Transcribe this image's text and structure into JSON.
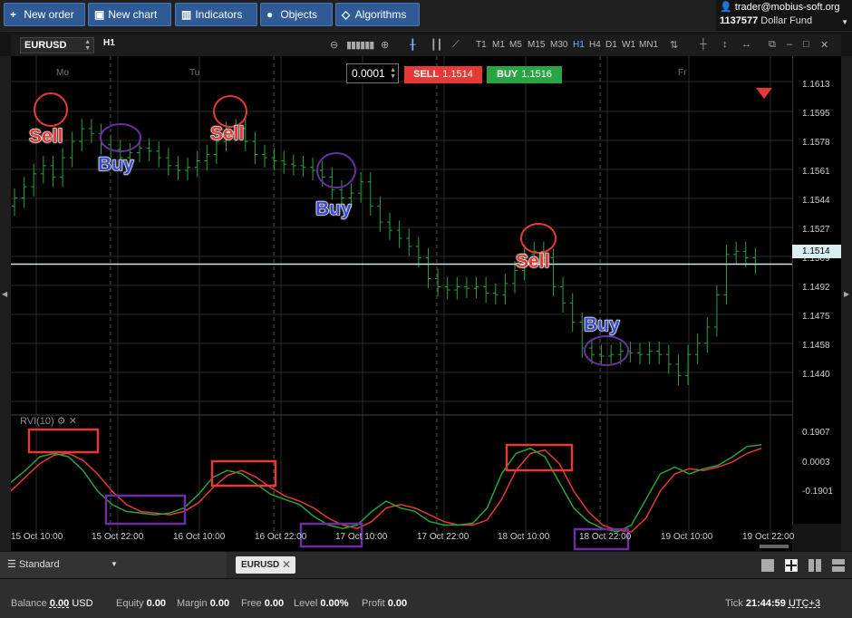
{
  "toolbar": {
    "new_order": "New order",
    "new_chart": "New chart",
    "indicators": "Indicators",
    "objects": "Objects",
    "algorithms": "Algorithms"
  },
  "account": {
    "user": "trader@mobius-soft.org",
    "number": "1137577",
    "fund": "Dollar Fund"
  },
  "chart_toolbar": {
    "symbol": "EURUSD",
    "timeframe": "H1",
    "timeframes": [
      "T1",
      "M1",
      "M5",
      "M15",
      "M30",
      "H1",
      "H4",
      "D1",
      "W1",
      "MN1"
    ],
    "active_timeframe": "H1"
  },
  "order": {
    "quantity": "0.0001",
    "sell_label": "SELL",
    "sell_price": "1.1514",
    "buy_label": "BUY",
    "buy_price": "1.1516"
  },
  "price_axis": {
    "labels": [
      "1.1613",
      "1.1595",
      "1.1578",
      "1.1561",
      "1.1544",
      "1.1527",
      "1.1509",
      "1.1492",
      "1.1475",
      "1.1458",
      "1.1440"
    ],
    "current": "1.1514"
  },
  "indicator": {
    "name": "RVI(10)",
    "labels": [
      "0.1907",
      "0.0003",
      "-0.1901"
    ]
  },
  "day_labels": [
    "Mo",
    "Tu",
    "Fr"
  ],
  "time_axis": [
    "15 Oct 10:00",
    "15 Oct 22:00",
    "16 Oct 10:00",
    "16 Oct 22:00",
    "17 Oct 10:00",
    "17 Oct 22:00",
    "18 Oct 10:00",
    "18 Oct 22:00",
    "19 Oct 10:00",
    "19 Oct 22:00"
  ],
  "annotations": {
    "sell": "Sell",
    "buy": "Buy"
  },
  "chart_data": {
    "type": "bar",
    "title": "",
    "ylim": [
      1.1425,
      1.1635
    ],
    "current_price": 1.1514,
    "ohlc_close": [
      1.1555,
      1.1562,
      1.157,
      1.1575,
      1.1568,
      1.158,
      1.159,
      1.1598,
      1.1595,
      1.1588,
      1.1585,
      1.158,
      1.1583,
      1.1586,
      1.1584,
      1.158,
      1.1575,
      1.1572,
      1.1574,
      1.1578,
      1.1582,
      1.159,
      1.1596,
      1.1598,
      1.159,
      1.1582,
      1.158,
      1.1578,
      1.1576,
      1.1575,
      1.1574,
      1.1572,
      1.1568,
      1.156,
      1.1555,
      1.1558,
      1.1565,
      1.155,
      1.154,
      1.1535,
      1.153,
      1.1525,
      1.1518,
      1.1505,
      1.15,
      1.1498,
      1.15,
      1.1499,
      1.15,
      1.1496,
      1.1495,
      1.1502,
      1.151,
      1.152,
      1.1522,
      1.1518,
      1.15,
      1.149,
      1.1478,
      1.1462,
      1.1458,
      1.1457,
      1.1458,
      1.146,
      1.1459,
      1.1458,
      1.146,
      1.1458,
      1.1452,
      1.1445,
      1.1458,
      1.1465,
      1.1475,
      1.1495,
      1.152,
      1.1522,
      1.1518,
      1.1514
    ],
    "rvi_ylim": [
      -0.32,
      0.36
    ],
    "rvi_main": [
      0.05,
      0.12,
      0.2,
      0.22,
      0.2,
      0.12,
      0.0,
      -0.08,
      -0.12,
      -0.13,
      -0.14,
      -0.13,
      -0.1,
      -0.02,
      0.08,
      0.12,
      0.1,
      0.04,
      -0.02,
      -0.05,
      -0.08,
      -0.15,
      -0.2,
      -0.22,
      -0.2,
      -0.12,
      -0.06,
      -0.1,
      -0.12,
      -0.18,
      -0.2,
      -0.2,
      -0.19,
      -0.1,
      0.1,
      0.22,
      0.25,
      0.2,
      0.05,
      -0.1,
      -0.18,
      -0.22,
      -0.24,
      -0.2,
      -0.05,
      0.1,
      0.14,
      0.1,
      0.13,
      0.15,
      0.2,
      0.26,
      0.27
    ],
    "rvi_signal": [
      0.0,
      0.08,
      0.16,
      0.21,
      0.22,
      0.18,
      0.1,
      0.0,
      -0.08,
      -0.12,
      -0.13,
      -0.14,
      -0.12,
      -0.07,
      0.02,
      0.09,
      0.12,
      0.08,
      0.02,
      -0.03,
      -0.06,
      -0.1,
      -0.16,
      -0.2,
      -0.22,
      -0.18,
      -0.1,
      -0.08,
      -0.1,
      -0.14,
      -0.18,
      -0.2,
      -0.2,
      -0.17,
      -0.05,
      0.12,
      0.22,
      0.24,
      0.16,
      0.0,
      -0.12,
      -0.2,
      -0.23,
      -0.24,
      -0.16,
      0.0,
      0.1,
      0.13,
      0.12,
      0.14,
      0.17,
      0.22,
      0.25
    ]
  },
  "layout_select": "Standard",
  "tab": "EURUSD",
  "status": {
    "balance_label": "Balance",
    "balance": "0.00",
    "currency": "USD",
    "equity_label": "Equity",
    "equity": "0.00",
    "margin_label": "Margin",
    "margin": "0.00",
    "free_label": "Free",
    "free": "0.00",
    "level_label": "Level",
    "level": "0.00%",
    "profit_label": "Profit",
    "profit": "0.00",
    "tick_label": "Tick",
    "tick": "21:44:59",
    "timezone": "UTC+3"
  }
}
